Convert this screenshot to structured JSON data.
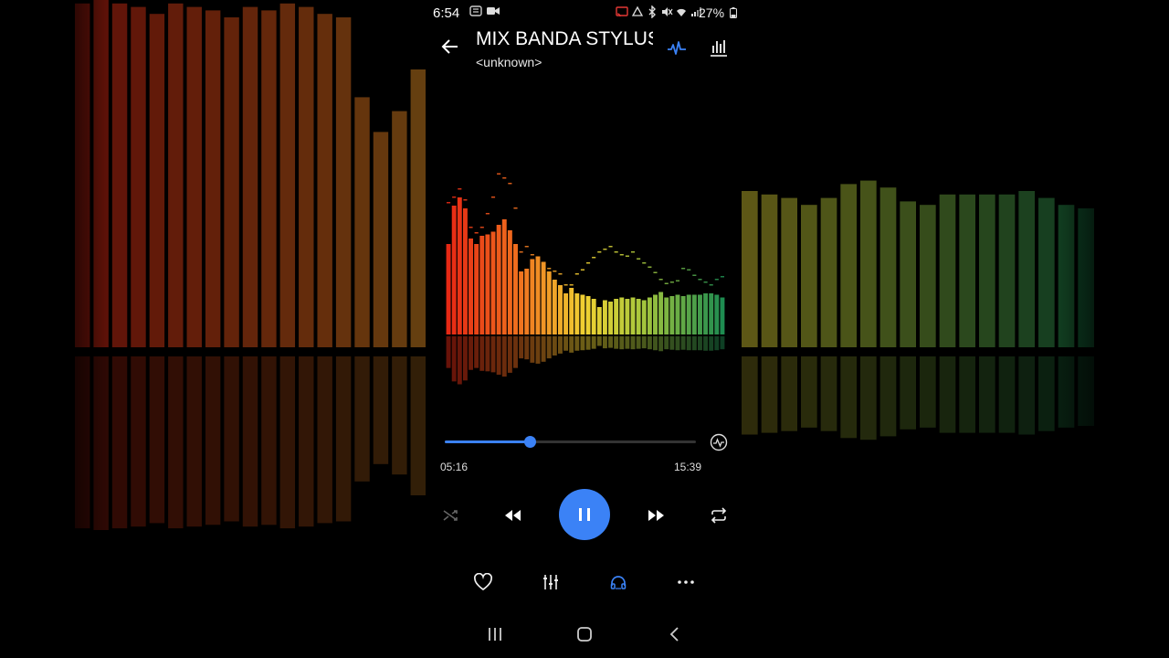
{
  "status_bar": {
    "time": "6:54",
    "battery": "27%"
  },
  "player": {
    "title": "MIX BANDA STYLUS",
    "artist": "<unknown>",
    "elapsed": "05:16",
    "duration": "15:39",
    "progress_fraction": 0.337
  },
  "icons": {
    "back": "arrow-left-icon",
    "visual_mode": "waveform-icon",
    "equalizer": "bar-chart-icon",
    "sleep_timer": "pulse-circle-icon",
    "shuffle": "shuffle-icon",
    "previous": "rewind-icon",
    "play_pause": "pause-icon",
    "next": "fast-forward-icon",
    "repeat": "repeat-icon",
    "favorite": "heart-icon",
    "eq_sliders": "sliders-icon",
    "audio_output": "headphones-icon",
    "more": "more-dots-icon"
  },
  "colors": {
    "accent": "#3b82f6",
    "background": "#000000"
  },
  "spectrum_levels": [
    0.66,
    0.94,
    1.0,
    0.92,
    0.7,
    0.66,
    0.72,
    0.73,
    0.75,
    0.8,
    0.84,
    0.76,
    0.66,
    0.46,
    0.48,
    0.55,
    0.57,
    0.53,
    0.46,
    0.4,
    0.36,
    0.3,
    0.34,
    0.3,
    0.29,
    0.28,
    0.26,
    0.2,
    0.25,
    0.24,
    0.26,
    0.27,
    0.26,
    0.27,
    0.26,
    0.25,
    0.27,
    0.29,
    0.31,
    0.27,
    0.28,
    0.29,
    0.28,
    0.29,
    0.29,
    0.29,
    0.3,
    0.3,
    0.29,
    0.27
  ],
  "spectrum_peaks": [
    0.94,
    0.98,
    1.04,
    0.96,
    0.76,
    0.72,
    0.76,
    0.86,
    0.98,
    1.15,
    1.12,
    1.08,
    0.9,
    0.58,
    0.62,
    0.56,
    0.52,
    0.5,
    0.46,
    0.44,
    0.42,
    0.34,
    0.34,
    0.42,
    0.45,
    0.5,
    0.54,
    0.58,
    0.6,
    0.62,
    0.58,
    0.56,
    0.55,
    0.58,
    0.53,
    0.5,
    0.47,
    0.43,
    0.38,
    0.35,
    0.36,
    0.37,
    0.46,
    0.45,
    0.41,
    0.38,
    0.36,
    0.34,
    0.38,
    0.4
  ]
}
